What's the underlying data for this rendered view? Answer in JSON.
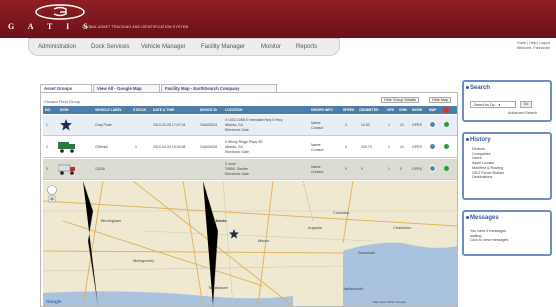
{
  "brand": {
    "name": "G A T I S",
    "tagline": "GLOBAL ASSET TRACKING AND IDENTIFICATION SYSTEM"
  },
  "nav": [
    "Administration",
    "Dock Services",
    "Vehicle Manager",
    "Facility Manager",
    "Monitor",
    "Reports"
  ],
  "topright": {
    "links": "Home | Help | Logout",
    "welcome": "Welcome, Panhandle"
  },
  "tabs": [
    "Asset Groups",
    "View All - Google Map",
    "Facility Map - EarthSearch Company"
  ],
  "group_label": "Chosen Fleet Group",
  "buttons": {
    "hide_group": "Hide Group Details",
    "hide_map": "Hide Map"
  },
  "columns": [
    "NO.",
    "ICON",
    "VEHICLE LABEL",
    "STATUS",
    "DATE & TIME",
    "DEVICE ID",
    "LOCATION",
    "DRIVER INFO",
    "SPEED",
    "ODOMETER",
    "GPS",
    "GSM",
    "MODE",
    "MAP",
    ""
  ],
  "rows": [
    {
      "no": "1",
      "label": "Gray Pade",
      "status": "",
      "date": "2010-02-25 17:07:04",
      "device": "GAA00024",
      "loc1": "0 1002-1056 E Interstate Hwy N Hwy",
      "loc2": "Atlanta, GA",
      "loc3": "Electronic Gate",
      "driver1": "Name:",
      "driver2": "Contact:",
      "speed": "0",
      "odo": "14.53",
      "gps": "1",
      "gsm": "22",
      "mode": "GPRS",
      "dot": "#2e9b3c"
    },
    {
      "no": "2",
      "label": "G95mini",
      "status": "1",
      "date": "2010-04-09 10:02:08",
      "device": "GAA00026",
      "loc1": "0 Windy Ridge Pkwy SE",
      "loc2": "Atlanta, GA",
      "loc3": "Electronic Gate",
      "driver1": "Name:",
      "driver2": "Contact:",
      "speed": "0",
      "odo": "229.73",
      "gps": "1",
      "gsm": "21",
      "mode": "GPRS",
      "dot": "#2e9b3c"
    },
    {
      "no": "3",
      "label": "13159",
      "status": "",
      "date": "",
      "device": "",
      "loc1": "0 none",
      "loc2": "T9850, Shelter",
      "loc3": "Electronic Gate",
      "driver1": "Name:",
      "driver2": "Contact:",
      "speed": "0",
      "odo": "0",
      "gps": "1",
      "gsm": "0",
      "mode": "GPRS",
      "dot": "#2e9b3c"
    }
  ],
  "map": {
    "labels": [
      "Birmingham",
      "Atlanta",
      "Montgomery",
      "Savannah",
      "Jacksonville",
      "Columbia",
      "Tallahassee",
      "Macon",
      "Augusta",
      "Charleston"
    ],
    "footer": "Map data ©2010 Google"
  },
  "search": {
    "title": "Search",
    "select": "- Select An Op... ▾",
    "go": "Go",
    "advanced": "Advanced Search"
  },
  "history": {
    "title": "History",
    "items": [
      "Devices",
      "Companies",
      "Users",
      "Asset Locator",
      "Manifest & Routing",
      "GEO Fence Builder",
      "Destinations"
    ]
  },
  "messages": {
    "title": "Messages",
    "text": [
      "You have 0 messages",
      "waiting",
      "Click to view messages"
    ]
  },
  "colors": {
    "header": "#7c1a20",
    "table_head": "#4c7eac",
    "side_border": "#6c8fbf"
  }
}
